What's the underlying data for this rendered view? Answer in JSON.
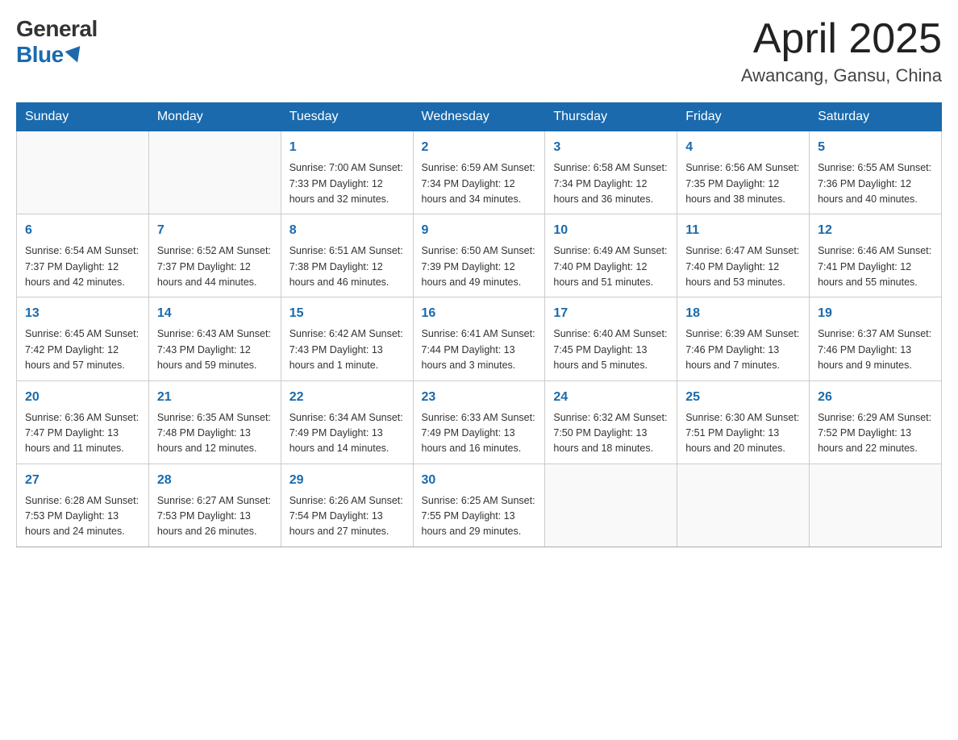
{
  "header": {
    "logo_general": "General",
    "logo_blue": "Blue",
    "month_title": "April 2025",
    "location": "Awancang, Gansu, China"
  },
  "days_of_week": [
    "Sunday",
    "Monday",
    "Tuesday",
    "Wednesday",
    "Thursday",
    "Friday",
    "Saturday"
  ],
  "weeks": [
    [
      {
        "day": "",
        "info": ""
      },
      {
        "day": "",
        "info": ""
      },
      {
        "day": "1",
        "info": "Sunrise: 7:00 AM\nSunset: 7:33 PM\nDaylight: 12 hours\nand 32 minutes."
      },
      {
        "day": "2",
        "info": "Sunrise: 6:59 AM\nSunset: 7:34 PM\nDaylight: 12 hours\nand 34 minutes."
      },
      {
        "day": "3",
        "info": "Sunrise: 6:58 AM\nSunset: 7:34 PM\nDaylight: 12 hours\nand 36 minutes."
      },
      {
        "day": "4",
        "info": "Sunrise: 6:56 AM\nSunset: 7:35 PM\nDaylight: 12 hours\nand 38 minutes."
      },
      {
        "day": "5",
        "info": "Sunrise: 6:55 AM\nSunset: 7:36 PM\nDaylight: 12 hours\nand 40 minutes."
      }
    ],
    [
      {
        "day": "6",
        "info": "Sunrise: 6:54 AM\nSunset: 7:37 PM\nDaylight: 12 hours\nand 42 minutes."
      },
      {
        "day": "7",
        "info": "Sunrise: 6:52 AM\nSunset: 7:37 PM\nDaylight: 12 hours\nand 44 minutes."
      },
      {
        "day": "8",
        "info": "Sunrise: 6:51 AM\nSunset: 7:38 PM\nDaylight: 12 hours\nand 46 minutes."
      },
      {
        "day": "9",
        "info": "Sunrise: 6:50 AM\nSunset: 7:39 PM\nDaylight: 12 hours\nand 49 minutes."
      },
      {
        "day": "10",
        "info": "Sunrise: 6:49 AM\nSunset: 7:40 PM\nDaylight: 12 hours\nand 51 minutes."
      },
      {
        "day": "11",
        "info": "Sunrise: 6:47 AM\nSunset: 7:40 PM\nDaylight: 12 hours\nand 53 minutes."
      },
      {
        "day": "12",
        "info": "Sunrise: 6:46 AM\nSunset: 7:41 PM\nDaylight: 12 hours\nand 55 minutes."
      }
    ],
    [
      {
        "day": "13",
        "info": "Sunrise: 6:45 AM\nSunset: 7:42 PM\nDaylight: 12 hours\nand 57 minutes."
      },
      {
        "day": "14",
        "info": "Sunrise: 6:43 AM\nSunset: 7:43 PM\nDaylight: 12 hours\nand 59 minutes."
      },
      {
        "day": "15",
        "info": "Sunrise: 6:42 AM\nSunset: 7:43 PM\nDaylight: 13 hours\nand 1 minute."
      },
      {
        "day": "16",
        "info": "Sunrise: 6:41 AM\nSunset: 7:44 PM\nDaylight: 13 hours\nand 3 minutes."
      },
      {
        "day": "17",
        "info": "Sunrise: 6:40 AM\nSunset: 7:45 PM\nDaylight: 13 hours\nand 5 minutes."
      },
      {
        "day": "18",
        "info": "Sunrise: 6:39 AM\nSunset: 7:46 PM\nDaylight: 13 hours\nand 7 minutes."
      },
      {
        "day": "19",
        "info": "Sunrise: 6:37 AM\nSunset: 7:46 PM\nDaylight: 13 hours\nand 9 minutes."
      }
    ],
    [
      {
        "day": "20",
        "info": "Sunrise: 6:36 AM\nSunset: 7:47 PM\nDaylight: 13 hours\nand 11 minutes."
      },
      {
        "day": "21",
        "info": "Sunrise: 6:35 AM\nSunset: 7:48 PM\nDaylight: 13 hours\nand 12 minutes."
      },
      {
        "day": "22",
        "info": "Sunrise: 6:34 AM\nSunset: 7:49 PM\nDaylight: 13 hours\nand 14 minutes."
      },
      {
        "day": "23",
        "info": "Sunrise: 6:33 AM\nSunset: 7:49 PM\nDaylight: 13 hours\nand 16 minutes."
      },
      {
        "day": "24",
        "info": "Sunrise: 6:32 AM\nSunset: 7:50 PM\nDaylight: 13 hours\nand 18 minutes."
      },
      {
        "day": "25",
        "info": "Sunrise: 6:30 AM\nSunset: 7:51 PM\nDaylight: 13 hours\nand 20 minutes."
      },
      {
        "day": "26",
        "info": "Sunrise: 6:29 AM\nSunset: 7:52 PM\nDaylight: 13 hours\nand 22 minutes."
      }
    ],
    [
      {
        "day": "27",
        "info": "Sunrise: 6:28 AM\nSunset: 7:53 PM\nDaylight: 13 hours\nand 24 minutes."
      },
      {
        "day": "28",
        "info": "Sunrise: 6:27 AM\nSunset: 7:53 PM\nDaylight: 13 hours\nand 26 minutes."
      },
      {
        "day": "29",
        "info": "Sunrise: 6:26 AM\nSunset: 7:54 PM\nDaylight: 13 hours\nand 27 minutes."
      },
      {
        "day": "30",
        "info": "Sunrise: 6:25 AM\nSunset: 7:55 PM\nDaylight: 13 hours\nand 29 minutes."
      },
      {
        "day": "",
        "info": ""
      },
      {
        "day": "",
        "info": ""
      },
      {
        "day": "",
        "info": ""
      }
    ]
  ]
}
